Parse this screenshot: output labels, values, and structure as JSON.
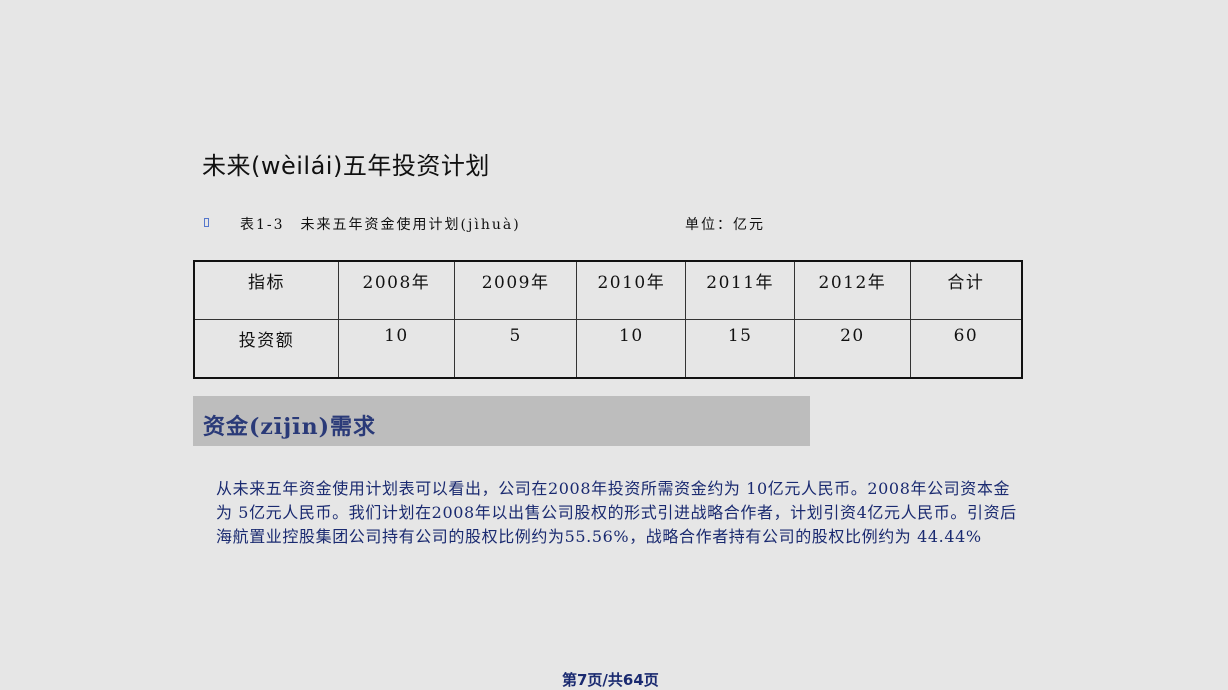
{
  "slide": {
    "title": "未来(wèilái)五年投资计划",
    "table_caption": "表1-3　未来五年资金使用计划(jìhuà)",
    "unit_label": "单位：亿元"
  },
  "table": {
    "headers": [
      "指标",
      "2008年",
      "2009年",
      "2010年",
      "2011年",
      "2012年",
      "合计"
    ],
    "rows": [
      [
        "投资额",
        "10",
        "5",
        "10",
        "15",
        "20",
        "60"
      ]
    ]
  },
  "section": {
    "title": "资金(zījīn)需求",
    "paragraph": "从未来五年资金使用计划表可以看出，公司在2008年投资所需资金约为 10亿元人民币。2008年公司资本金为 5亿元人民币。我们计划在2008年以出售公司股权的形式引进战略合作者，计划引资4亿元人民币。引资后海航置业控股集团公司持有公司的股权比例约为55.56%，战略合作者持有公司的股权比例约为 44.44%"
  },
  "footer": {
    "page_label": "第7页/共64页"
  }
}
